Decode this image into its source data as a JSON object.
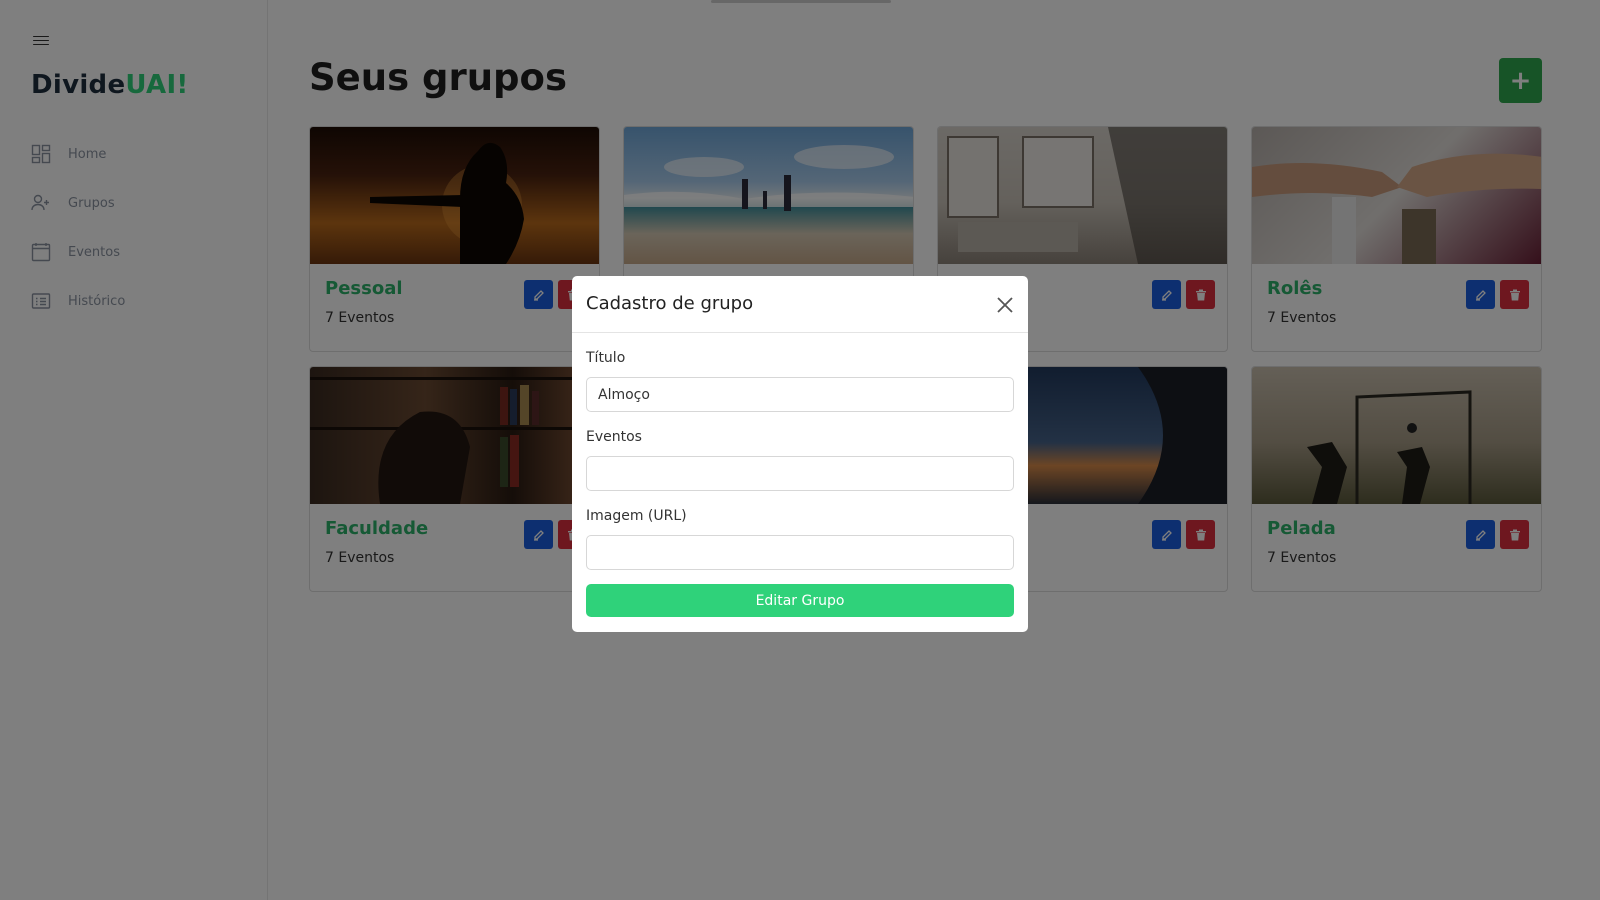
{
  "app": {
    "logo_part1": "Divide",
    "logo_part2": "UAI!"
  },
  "sidebar": {
    "items": [
      {
        "label": "Home",
        "icon": "grid-icon"
      },
      {
        "label": "Grupos",
        "icon": "user-plus-icon"
      },
      {
        "label": "Eventos",
        "icon": "calendar-icon"
      },
      {
        "label": "Histórico",
        "icon": "list-icon"
      }
    ]
  },
  "main": {
    "title": "Seus grupos",
    "add_label": "+"
  },
  "groups": [
    {
      "title": "Pessoal",
      "count": "7 Eventos"
    },
    {
      "title": "",
      "count": ""
    },
    {
      "title": "",
      "count": ""
    },
    {
      "title": "Rolês",
      "count": "7 Eventos"
    },
    {
      "title": "Faculdade",
      "count": "7 Eventos"
    },
    {
      "title": "",
      "count": ""
    },
    {
      "title": "",
      "count": ""
    },
    {
      "title": "Pelada",
      "count": "7 Eventos"
    }
  ],
  "modal": {
    "title": "Cadastro de grupo",
    "fields": {
      "titulo_label": "Título",
      "titulo_value": "Almoço",
      "eventos_label": "Eventos",
      "eventos_value": "",
      "imagem_label": "Imagem (URL)",
      "imagem_value": ""
    },
    "submit_label": "Editar Grupo"
  },
  "colors": {
    "brand_dark": "#1f2f3f",
    "brand_green": "#2fd27a",
    "edit_blue": "#1b5fe0",
    "delete_red": "#dc2f3f",
    "add_green": "#2ea84f"
  }
}
